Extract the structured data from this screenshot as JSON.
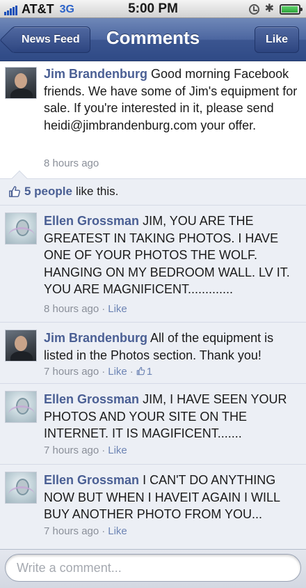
{
  "status_bar": {
    "carrier": "AT&T",
    "network": "3G",
    "time": "5:00 PM",
    "bluetooth_symbol": "✱",
    "battery_level": 0.95
  },
  "nav": {
    "back_label": "News Feed",
    "title": "Comments",
    "like_label": "Like"
  },
  "post": {
    "author": "Jim Brandenburg",
    "text": "Good morning Facebook friends. We have some of Jim's equipment for sale. If you're interested in it, please send heidi@jimbrandenburg.com your offer.",
    "time": "8 hours ago"
  },
  "likes": {
    "count": "5 people",
    "suffix": "like this."
  },
  "comments": [
    {
      "author": "Ellen Grossman",
      "text": "JIM, YOU ARE THE GREATEST IN TAKING PHOTOS. I HAVE ONE OF YOUR PHOTOS THE WOLF. HANGING ON MY BEDROOM WALL. LV IT. YOU ARE MAGNIFICENT.............",
      "time": "8 hours ago",
      "like": "Like"
    },
    {
      "author": "Jim Brandenburg",
      "text": "All of the equipment is listed in the Photos section. Thank you!",
      "time": "7 hours ago",
      "like": "Like",
      "like_count": "1"
    },
    {
      "author": "Ellen Grossman",
      "text": "JIM, I HAVE SEEN YOUR PHOTOS AND YOUR SITE ON THE INTERNET. IT IS MAGIFICENT.......",
      "time": "7 hours ago",
      "like": "Like"
    },
    {
      "author": "Ellen Grossman",
      "text": "I CAN'T DO ANYTHING NOW BUT WHEN I HAVEIT AGAIN I WILL BUY ANOTHER PHOTO FROM YOU...",
      "time": "7 hours ago",
      "like": "Like"
    }
  ],
  "composer": {
    "placeholder": "Write a comment..."
  },
  "colors": {
    "nav_blue": "#3b5590",
    "author_blue": "#4a5f94",
    "link_blue": "#6d84b4",
    "comment_bg": "#eceff5"
  }
}
